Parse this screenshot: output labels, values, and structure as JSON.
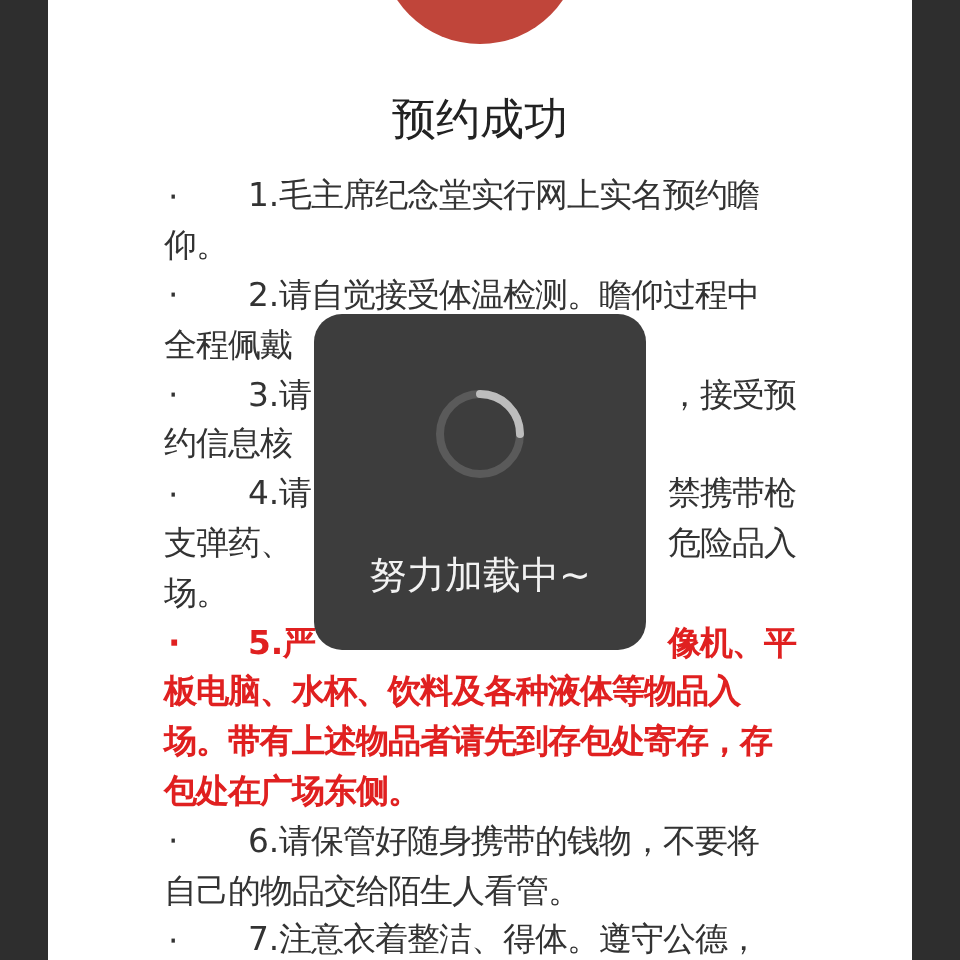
{
  "title": "预约成功",
  "notices": [
    {
      "bullet": "·",
      "highlighted": false,
      "lines": [
        [
          "1.毛主席纪念堂实行网上实名预约瞻"
        ],
        [
          "仰。"
        ]
      ]
    },
    {
      "bullet": "·",
      "highlighted": false,
      "lines": [
        [
          "2.请自觉接受体温检测。瞻仰过程中"
        ],
        [
          "全程佩戴"
        ]
      ]
    },
    {
      "bullet": "·",
      "highlighted": false,
      "lines": [
        [
          "3.请",
          "，接受预"
        ],
        [
          "约信息核"
        ]
      ]
    },
    {
      "bullet": "·",
      "highlighted": false,
      "lines": [
        [
          "4.请",
          "禁携带枪"
        ],
        [
          "支弹药、",
          "危险品入"
        ],
        [
          "场。"
        ]
      ]
    },
    {
      "bullet": "·",
      "highlighted": true,
      "lines": [
        [
          "5.严",
          "像机、平"
        ],
        [
          "板电脑、水杯、饮料及各种液体等物品入"
        ],
        [
          "场。带有上述物品者请先到存包处寄存，存"
        ],
        [
          "包处在广场东侧。"
        ]
      ]
    },
    {
      "bullet": "·",
      "highlighted": false,
      "lines": [
        [
          "6.请保管好随身携带的钱物，不要将"
        ],
        [
          "自己的物品交给陌生人看管。"
        ]
      ]
    },
    {
      "bullet": "·",
      "highlighted": false,
      "lines": [
        [
          "7.注意衣着整洁、得体。遵守公德，"
        ]
      ]
    }
  ],
  "loading": {
    "text": "努力加载中~"
  }
}
